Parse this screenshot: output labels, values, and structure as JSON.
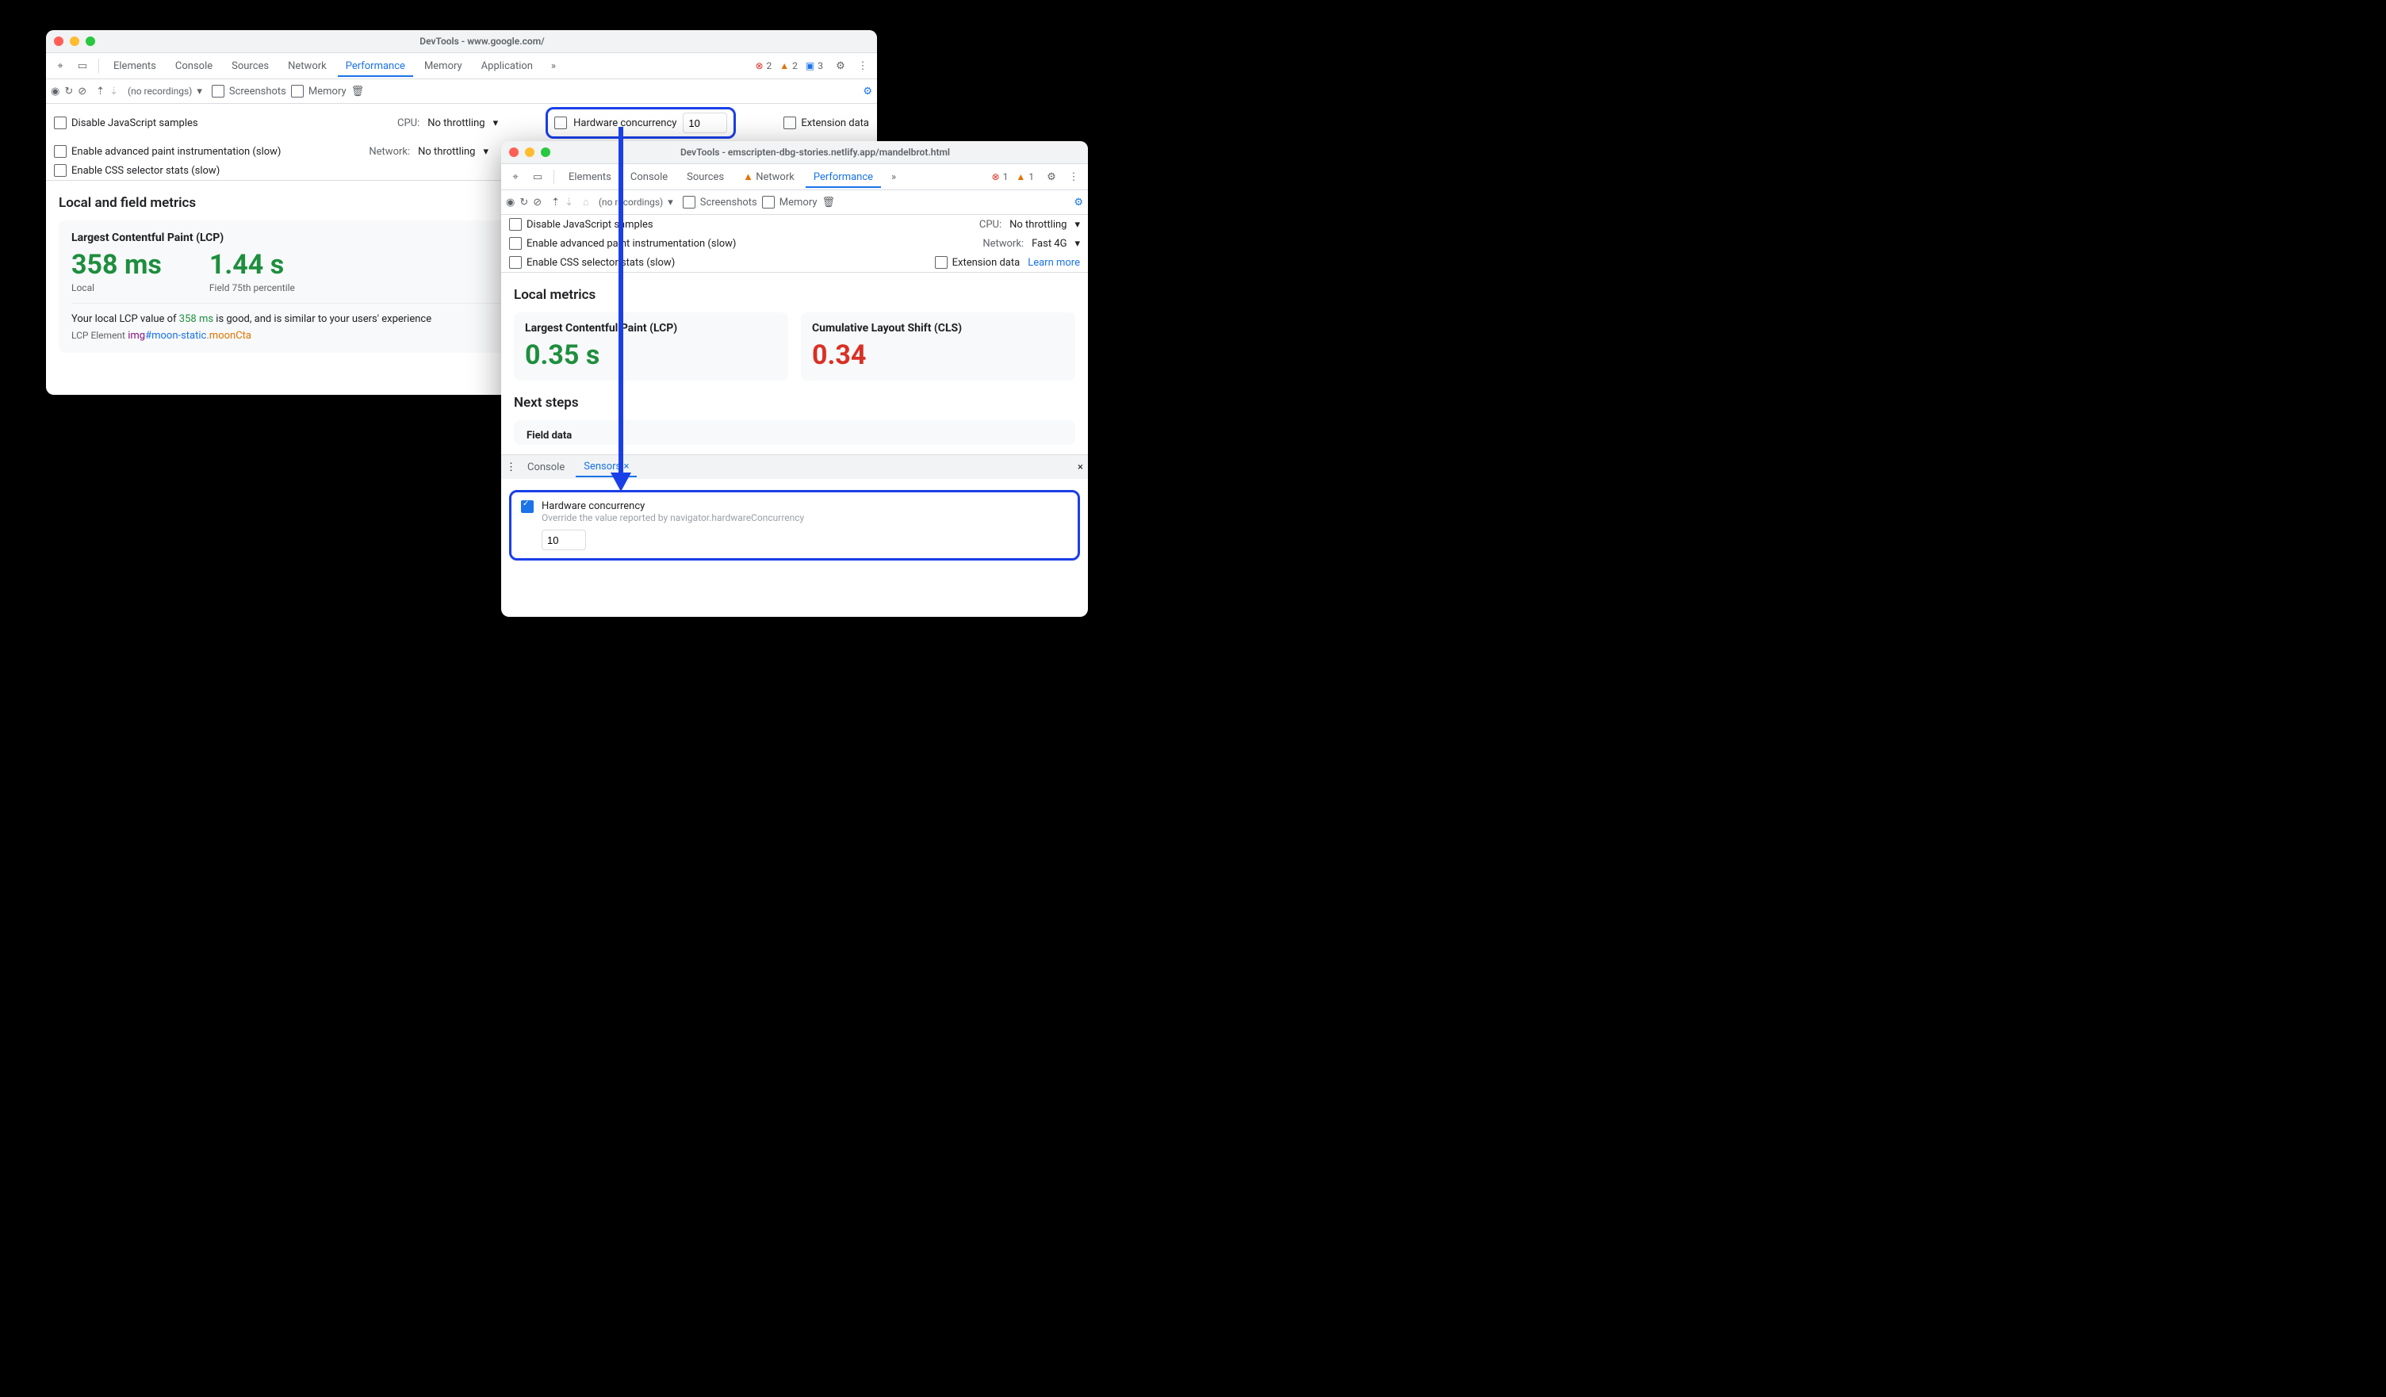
{
  "w1": {
    "title": "DevTools - www.google.com/",
    "tabs": [
      "Elements",
      "Console",
      "Sources",
      "Network",
      "Performance",
      "Memory",
      "Application"
    ],
    "active": "Performance",
    "counts": {
      "errors": 2,
      "warnings": 2,
      "info": 3
    },
    "toolbar": {
      "recordings": "(no recordings)",
      "screenshots": "Screenshots",
      "memory": "Memory"
    },
    "opts": {
      "disable_js": "Disable JavaScript samples",
      "paint": "Enable advanced paint instrumentation (slow)",
      "css": "Enable CSS selector stats (slow)",
      "cpu_label": "CPU:",
      "cpu_value": "No throttling",
      "net_label": "Network:",
      "net_value": "No throttling",
      "hw_label": "Hardware concurrency",
      "hw_value": "10",
      "ext": "Extension data"
    },
    "heading": "Local and field metrics",
    "metric_name": "Largest Contentful Paint (LCP)",
    "local_value": "358 ms",
    "local_sub": "Local",
    "field_value": "1.44 s",
    "field_sub": "Field 75th percentile",
    "sentence_a": "Your local LCP value of ",
    "sentence_val": "358 ms",
    "sentence_b": " is good, and is similar to your users' experience",
    "lcp_el_label": "LCP Element",
    "lcp_tag": "img",
    "lcp_id": "#moon-static",
    "lcp_cls": ".moonCta"
  },
  "w2": {
    "title": "DevTools - emscripten-dbg-stories.netlify.app/mandelbrot.html",
    "tabs": [
      "Elements",
      "Console",
      "Sources",
      "Network",
      "Performance"
    ],
    "active": "Performance",
    "counts": {
      "errors": 1,
      "warnings": 1
    },
    "toolbar": {
      "recordings": "(no recordings)",
      "screenshots": "Screenshots",
      "memory": "Memory"
    },
    "opts": {
      "disable_js": "Disable JavaScript samples",
      "paint": "Enable advanced paint instrumentation (slow)",
      "css": "Enable CSS selector stats (slow)",
      "cpu_label": "CPU:",
      "cpu_value": "No throttling",
      "net_label": "Network:",
      "net_value": "Fast 4G",
      "ext": "Extension data",
      "learn": "Learn more"
    },
    "heading": "Local metrics",
    "lcp_name": "Largest Contentful Paint (LCP)",
    "lcp_value": "0.35 s",
    "cls_name": "Cumulative Layout Shift (CLS)",
    "cls_value": "0.34",
    "next_steps": "Next steps",
    "field_data": "Field data",
    "drawer": {
      "console": "Console",
      "sensors": "Sensors",
      "hw_label": "Hardware concurrency",
      "hw_desc": "Override the value reported by navigator.hardwareConcurrency",
      "hw_value": "10"
    }
  }
}
